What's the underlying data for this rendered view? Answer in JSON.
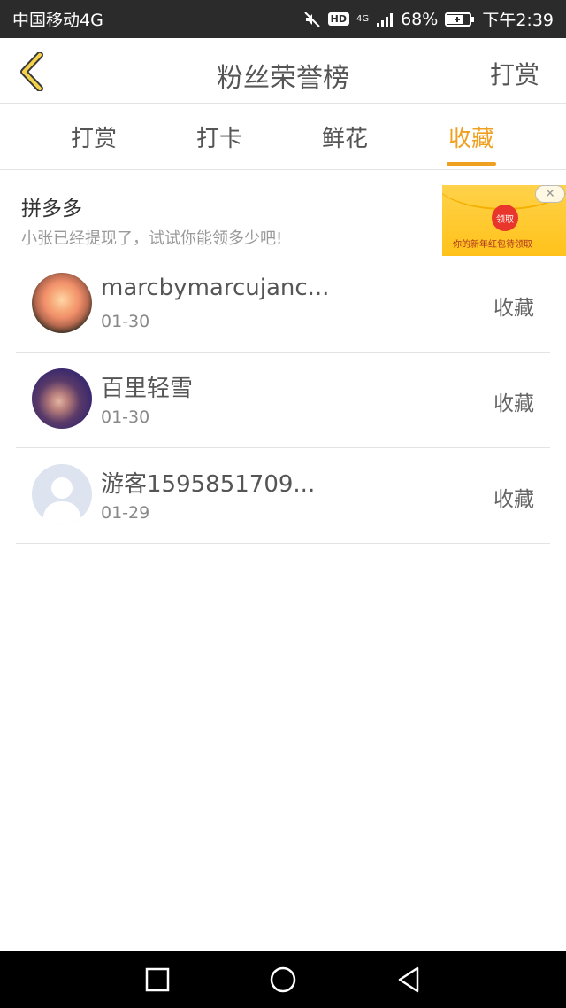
{
  "status_bar": {
    "carrier": "中国移动4G",
    "hd": "HD",
    "network": "4G",
    "battery": "68%",
    "time": "下午2:39"
  },
  "header": {
    "title": "粉丝荣誉榜",
    "action": "打赏"
  },
  "tabs": [
    {
      "label": "打赏"
    },
    {
      "label": "打卡"
    },
    {
      "label": "鲜花"
    },
    {
      "label": "收藏"
    }
  ],
  "ad": {
    "title": "拼多多",
    "description": "小张已经提现了，试试你能领多少吧!",
    "seal_text": "领取",
    "caption": "你的新年红包待领取"
  },
  "list": [
    {
      "name": "marcbymarcujanc...",
      "date": "01-30",
      "action": "收藏"
    },
    {
      "name": "百里轻雪",
      "date": "01-30",
      "action": "收藏"
    },
    {
      "name": "游客1595851709...",
      "date": "01-29",
      "action": "收藏"
    }
  ],
  "colors": {
    "accent": "#f0a020",
    "status_bar_bg": "#2b2b2b",
    "nav_bar_bg": "#000000"
  }
}
